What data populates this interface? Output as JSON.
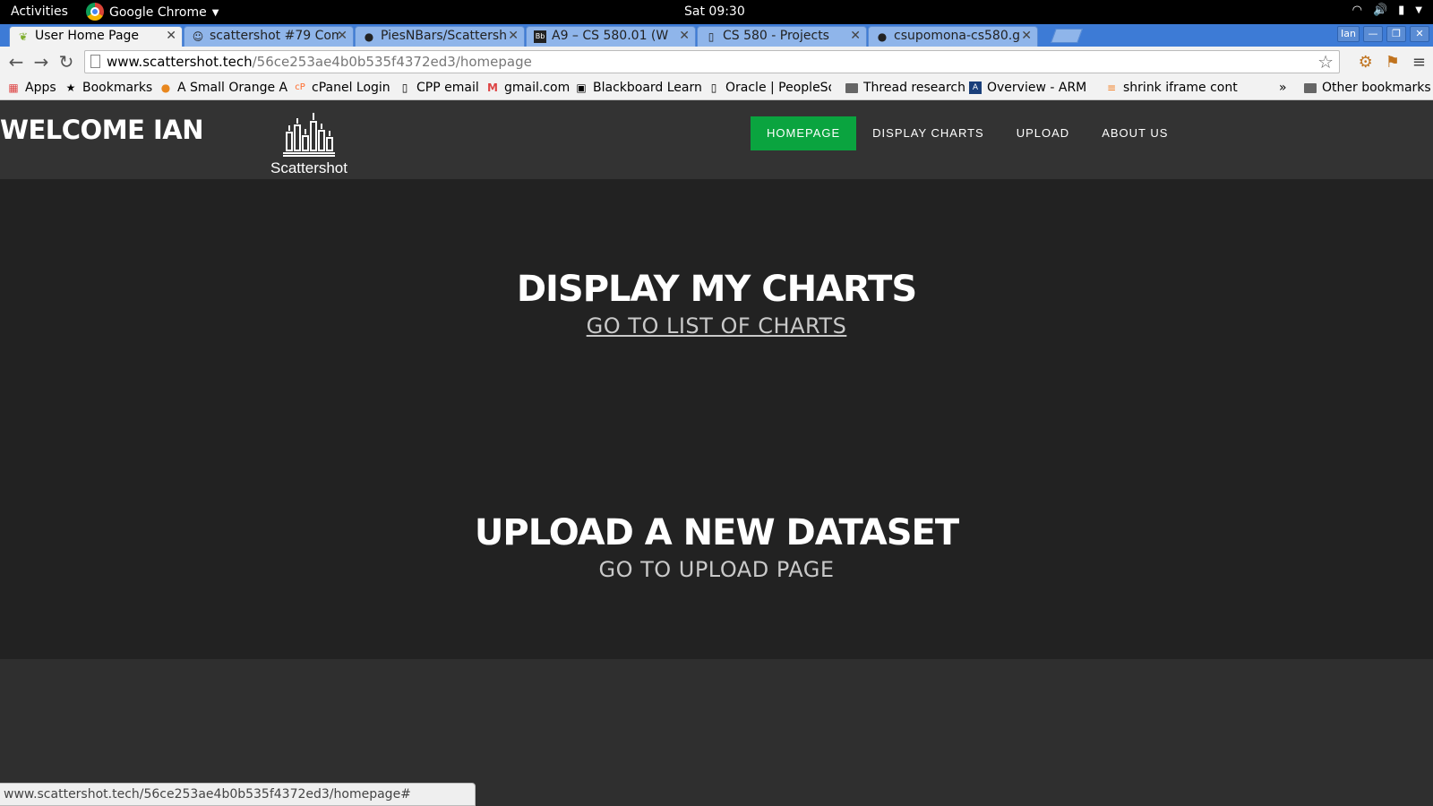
{
  "os": {
    "activities": "Activities",
    "app_name": "Google Chrome",
    "clock": "Sat 09:30",
    "status_icons": [
      "wifi-icon",
      "volume-icon",
      "battery-icon",
      "caret-down-icon"
    ]
  },
  "tabs": [
    {
      "title": "User Home Page",
      "icon": "leaf-icon",
      "active": true
    },
    {
      "title": "scattershot #79 Com",
      "icon": "avatar-icon",
      "active": false
    },
    {
      "title": "PiesNBars/Scattersh",
      "icon": "github-icon",
      "active": false
    },
    {
      "title": "A9 – CS 580.01 (W",
      "icon": "blackboard-icon",
      "active": false
    },
    {
      "title": "CS 580 - Projects",
      "icon": "page-icon",
      "active": false
    },
    {
      "title": "csupomona-cs580.g",
      "icon": "github-icon",
      "active": false
    }
  ],
  "window": {
    "user_badge": "Ian"
  },
  "omnibox": {
    "host": "www.scattershot.tech",
    "path": "/56ce253ae4b0b535f4372ed3/homepage"
  },
  "bookmarks": {
    "items": [
      {
        "label": "Apps",
        "icon": "apps-grid-icon"
      },
      {
        "label": "Bookmarks",
        "icon": "star-icon"
      },
      {
        "label": "A Small Orange A",
        "icon": "orange-icon"
      },
      {
        "label": "cPanel Login",
        "icon": "cpanel-icon"
      },
      {
        "label": "CPP email",
        "icon": "page-icon"
      },
      {
        "label": "gmail.com",
        "icon": "gmail-icon"
      },
      {
        "label": "Blackboard Learn",
        "icon": "blackboard-icon"
      },
      {
        "label": "Oracle | PeopleSo",
        "icon": "page-icon"
      },
      {
        "label": "Thread research",
        "icon": "folder-icon"
      },
      {
        "label": "Overview - ARM (",
        "icon": "arm-icon"
      },
      {
        "label": "shrink iframe cont",
        "icon": "stackoverflow-icon"
      }
    ],
    "overflow": "»",
    "other": "Other bookmarks"
  },
  "site": {
    "welcome": "WELCOME IAN",
    "logo_text": "Scattershot",
    "nav": [
      {
        "label": "HOMEPAGE",
        "active": true
      },
      {
        "label": "DISPLAY CHARTS",
        "active": false
      },
      {
        "label": "UPLOAD",
        "active": false
      },
      {
        "label": "ABOUT US",
        "active": false
      }
    ],
    "sections": [
      {
        "title": "DISPLAY MY CHARTS",
        "link": "GO TO LIST OF CHARTS"
      },
      {
        "title": "UPLOAD A NEW DATASET",
        "link": "GO TO UPLOAD PAGE"
      }
    ],
    "accent_color": "#0aa43f"
  },
  "statusbar": {
    "text": "www.scattershot.tech/56ce253ae4b0b535f4372ed3/homepage#"
  }
}
